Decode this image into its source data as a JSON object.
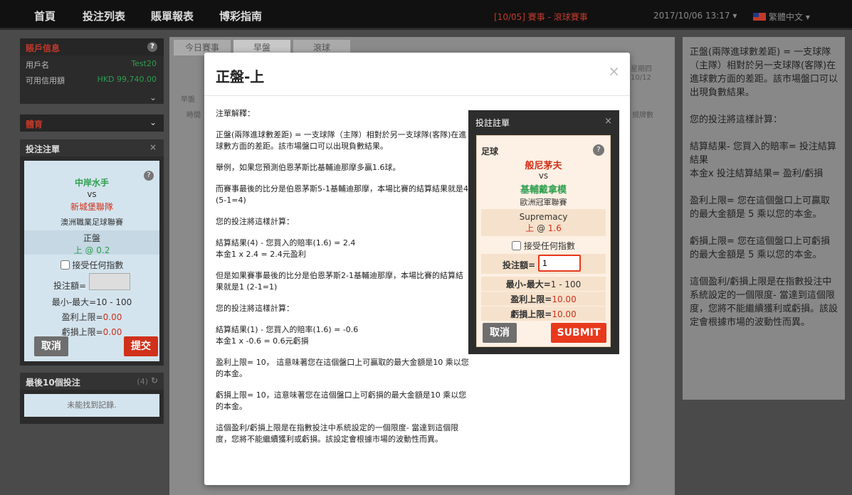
{
  "nav": {
    "items": [
      "首頁",
      "投注列表",
      "賬單報表",
      "博彩指南"
    ],
    "event_label": "[10/05] 賽事 - 滾球賽事",
    "datetime": "2017/10/06 13:17",
    "language": "繁體中文"
  },
  "account": {
    "title": "賬戶信息",
    "username_label": "用戶名",
    "username": "Test20",
    "credit_label": "可用信用額",
    "credit": "HKD 99,740.00"
  },
  "sports": {
    "title": "體育"
  },
  "left_slip": {
    "title": "投注注單",
    "home": "中岸水手",
    "vs": "vs",
    "away": "新城堡聯隊",
    "league": "澳洲職業足球聯賽",
    "market": "正盤",
    "pick_side": "上",
    "pick_at": "@",
    "pick_odds": "0.2",
    "accept_any_odds": "接受任何指數",
    "stake_label": "投注額=",
    "minmax": "最小-最大=10 - 100",
    "profit_limit_label": "盈利上限=",
    "profit_limit": "0.00",
    "loss_limit_label": "虧損上限=",
    "loss_limit": "0.00",
    "cancel": "取消",
    "submit": "提交"
  },
  "recent": {
    "title": "最後10個投注",
    "count": "(4)",
    "empty": "未能找到記錄."
  },
  "bg": {
    "tabs": [
      "今日賽事",
      "早盤",
      "滾球"
    ],
    "early_label": "早盤",
    "time_col": "時間",
    "weekday": "星期四",
    "date": "10/12",
    "rules_link": "規牌數"
  },
  "right_panel": {
    "paragraphs": [
      "正盤(兩隊進球數差距) = 一支球隊（主隊）相對於另一支球隊(客隊)在進球數方面的差距。該市場盤口可以出現負數結果。",
      "您的投注將這樣計算：",
      "結算結果- 您買入的賠率= 投注結算結果\n本金x 投注結算結果= 盈利/虧損",
      "盈利上限= 您在這個盤口上可贏取的最大金額是 5 乘以您的本金。",
      "虧損上限= 您在這個盤口上可虧損的最大金額是 5 乘以您的本金。",
      "這個盈利/虧損上限是在指數投注中系統設定的一個限度- 當達到這個限度，您將不能繼續獲利或虧損。該設定會根據市場的波動性而異。"
    ]
  },
  "modal": {
    "title": "正盤-上",
    "close": "×",
    "paragraphs": [
      "注單解釋：",
      "正盤(兩隊進球數差距) = 一支球隊（主隊）相對於另一支球隊(客隊)在進球數方面的差距。該市場盤口可以出現負數結果。",
      "舉例，如果您預測伯恩茅斯比基輔迪那摩多贏1.6球。",
      "而賽事最後的比分是伯恩茅斯5-1基輔迪那摩，本場比賽的結算結果就是4 (5-1=4)",
      "您的投注將這樣計算：",
      "結算結果(4) - 您買入的賠率(1.6) = 2.4\n本金1 x 2.4 = 2.4元盈利",
      "但是如果賽事最後的比分是伯恩茅斯2-1基輔迪那摩，本場比賽的結算結果就是1 (2-1=1)",
      "您的投注將這樣計算：",
      "結算結果(1) - 您買入的賠率(1.6) = -0.6\n本金1 x -0.6 = 0.6元虧損",
      "盈利上限= 10， 這意味著您在這個盤口上可贏取的最大金額是10 乘以您的本金。",
      "虧損上限= 10，這意味著您在這個盤口上可虧損的最大金額是10 乘以您的本金。",
      "這個盈利/虧損上限是在指數投注中系統設定的一個限度- 當達到這個限度，您將不能繼續獲利或虧損。該設定會根據市場的波動性而異。"
    ]
  },
  "slip": {
    "title": "投註註單",
    "close": "×",
    "sport": "足球",
    "home": "般尼茅夫",
    "vs": "vs",
    "away": "基輔戴拿模",
    "league": "歐洲冠軍聯賽",
    "market": "Supremacy",
    "pick_side": "上",
    "pick_at": "@",
    "pick_odds": "1.6",
    "accept_any_odds": "接受任何指數",
    "stake_label": "投注額=",
    "stake_value": "1",
    "minmax_label": "最小-最大=",
    "minmax_value": "1 - 100",
    "profit_limit_label": "盈利上限=",
    "profit_limit": "10.00",
    "loss_limit_label": "虧損上限=",
    "loss_limit": "10.00",
    "cancel": "取消",
    "submit": "SUBMIT"
  },
  "colors": {
    "accent_red": "#d0311b",
    "accent_green": "#2e9e4f",
    "submit": "#e8391d"
  }
}
